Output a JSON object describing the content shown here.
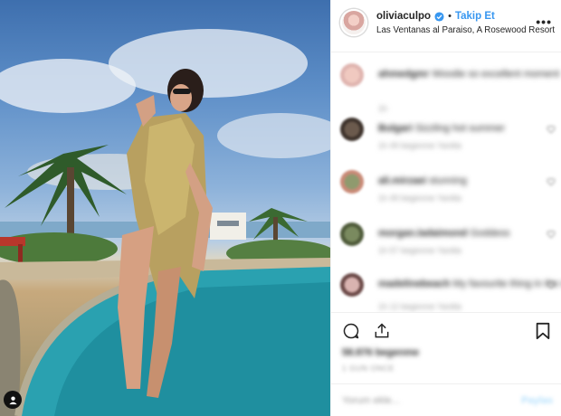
{
  "post": {
    "username": "oliviaculpo",
    "follow_label": "Takip Et",
    "separator": "•",
    "location": "Las Ventanas al Paraiso, A Rosewood Resort",
    "more_icon": "more-options-icon",
    "verified_icon": "verified-badge-icon"
  },
  "comments": [
    {
      "user": "ahmedgmr",
      "text": "Woodie so excellent moment",
      "meta": "1h"
    },
    {
      "user": "Bulgari",
      "text": "Sizzling hot summer",
      "meta": "1h   49 begenme   Yanitla"
    },
    {
      "user": "ali.mirzaei",
      "text": "stunning",
      "meta": "1h   49 begenme   Yanitla"
    },
    {
      "user": "morgan.ladaimond",
      "text": "Goddess",
      "meta": "1h   57 begenme   Yanitla"
    },
    {
      "user": "madelinebeach",
      "text": "My favourite thing in the world",
      "meta": "1h   12 begenme   Yanitla"
    }
  ],
  "actions": {
    "likes": "58.876 begenme",
    "date": "1 GUN ONCE",
    "comment_placeholder": "Yorum ekle...",
    "post_label": "Paylas"
  },
  "colors": {
    "accent": "#3897f0",
    "text": "#262626",
    "muted": "#999999",
    "border": "#efefef"
  }
}
